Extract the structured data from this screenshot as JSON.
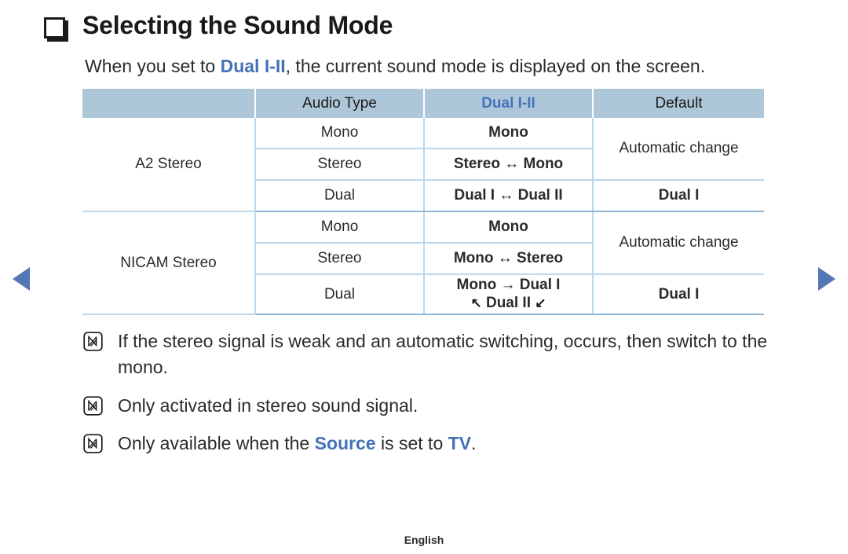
{
  "page": {
    "heading": "Selecting the Sound Mode",
    "heading_bullet_icon": "hollow-square-icon",
    "intro": {
      "before": "When you set to ",
      "highlight": "Dual I-II",
      "after": ", the current sound mode is displayed on the screen."
    },
    "footer": "English"
  },
  "nav": {
    "prev_icon": "triangle-left-icon",
    "next_icon": "triangle-right-icon",
    "accent_color": "#5578b4"
  },
  "table": {
    "headers": [
      "",
      "Audio Type",
      "Dual I-II",
      "Default"
    ],
    "header_bg": "#adc7d9",
    "accent_text": "#4472b8",
    "border_color": "#bcd6ea",
    "groups": [
      {
        "name": "A2 Stereo",
        "rows": [
          {
            "audio_type": "Mono",
            "dual": "Mono",
            "default": "Automatic change",
            "default_rowspan": 2
          },
          {
            "audio_type": "Stereo",
            "dual": "Stereo ↔ Mono",
            "default": null
          },
          {
            "audio_type": "Dual",
            "dual": "Dual I ↔ Dual II",
            "default": "Dual I",
            "default_blue": true
          }
        ]
      },
      {
        "name": "NICAM Stereo",
        "rows": [
          {
            "audio_type": "Mono",
            "dual": "Mono",
            "default": "Automatic change",
            "default_rowspan": 2
          },
          {
            "audio_type": "Stereo",
            "dual": "Mono ↔ Stereo",
            "default": null
          },
          {
            "audio_type": "Dual",
            "dual_line1": "Mono → Dual I",
            "dual_line2_left": "↖",
            "dual_line2_mid": "Dual II",
            "dual_line2_right": "↙",
            "default": "Dual I",
            "default_blue": true
          }
        ]
      }
    ]
  },
  "notes": [
    {
      "icon": "note-pencil-icon",
      "text": "If the stereo signal is weak and an automatic switching, occurs, then switch to the mono."
    },
    {
      "icon": "note-pencil-icon",
      "text": "Only activated in stereo sound signal."
    },
    {
      "icon": "note-pencil-icon",
      "before": "Only available when the ",
      "highlight1": "Source",
      "middle": " is set to ",
      "highlight2": "TV",
      "after": "."
    }
  ]
}
